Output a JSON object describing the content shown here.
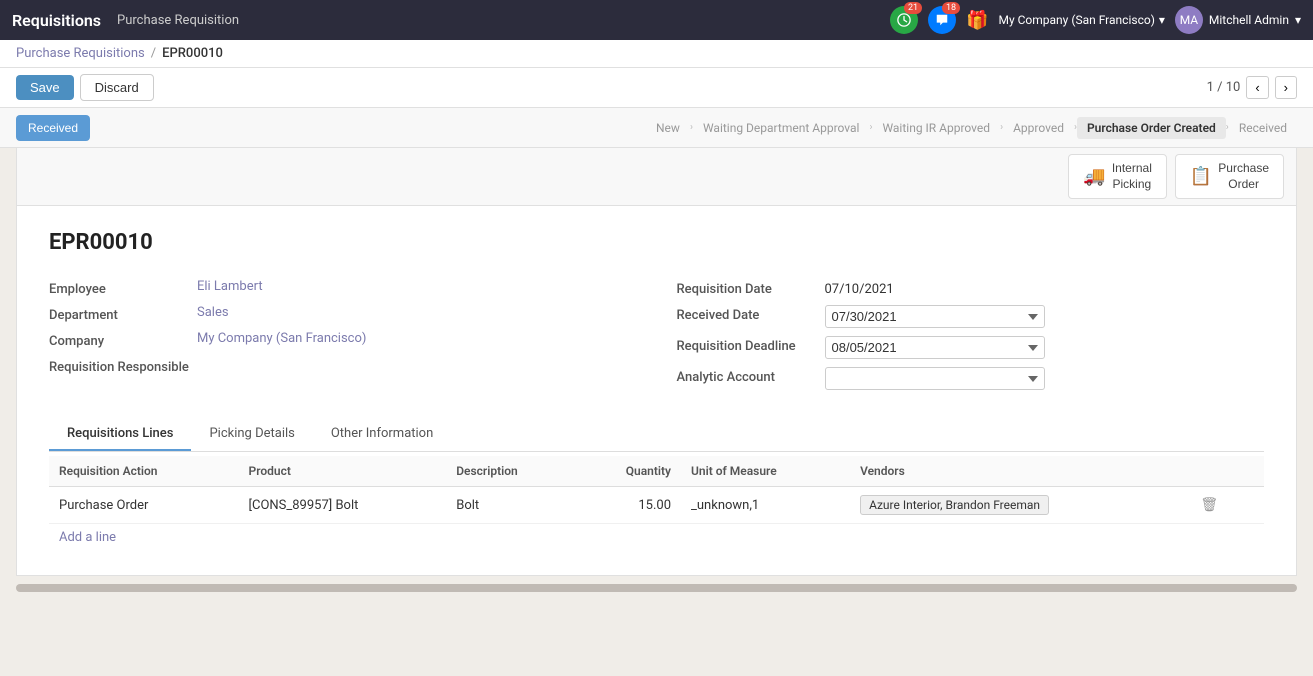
{
  "app": {
    "brand": "Requisitions",
    "module": "Purchase Requisition"
  },
  "topnav": {
    "notifications_count": "21",
    "messages_count": "18",
    "company": "My Company (San Francisco)",
    "user": "Mitchell Admin",
    "chevron": "▾"
  },
  "breadcrumb": {
    "parent": "Purchase Requisitions",
    "separator": "/",
    "current": "EPR00010"
  },
  "actions": {
    "save": "Save",
    "discard": "Discard",
    "pager": "1 / 10",
    "prev": "‹",
    "next": "›"
  },
  "status": {
    "received_label": "Received",
    "pipeline": [
      {
        "label": "New",
        "active": false
      },
      {
        "label": "Waiting Department Approval",
        "active": false
      },
      {
        "label": "Waiting IR Approved",
        "active": false
      },
      {
        "label": "Approved",
        "active": false
      },
      {
        "label": "Purchase Order Created",
        "active": true
      },
      {
        "label": "Received",
        "active": false
      }
    ]
  },
  "smart_buttons": [
    {
      "name": "internal-picking",
      "icon": "🚚",
      "label": "Internal\nPicking"
    },
    {
      "name": "purchase-order",
      "icon": "📋",
      "label": "Purchase\nOrder"
    }
  ],
  "form": {
    "title": "EPR00010",
    "left": {
      "employee_label": "Employee",
      "employee_value": "Eli Lambert",
      "department_label": "Department",
      "department_value": "Sales",
      "company_label": "Company",
      "company_value": "My Company (San Francisco)",
      "responsible_label": "Requisition Responsible",
      "responsible_value": ""
    },
    "right": {
      "req_date_label": "Requisition Date",
      "req_date_value": "07/10/2021",
      "received_date_label": "Received Date",
      "received_date_value": "07/30/2021",
      "req_deadline_label": "Requisition Deadline",
      "req_deadline_value": "08/05/2021",
      "analytic_label": "Analytic Account",
      "analytic_value": ""
    }
  },
  "tabs": [
    {
      "label": "Requisitions Lines",
      "active": true
    },
    {
      "label": "Picking Details",
      "active": false
    },
    {
      "label": "Other Information",
      "active": false
    }
  ],
  "table": {
    "columns": [
      "Requisition Action",
      "Product",
      "Description",
      "Quantity",
      "Unit of Measure",
      "Vendors"
    ],
    "rows": [
      {
        "action": "Purchase Order",
        "product": "[CONS_89957] Bolt",
        "description": "Bolt",
        "quantity": "15.00",
        "uom": "_unknown,1",
        "vendor": "Azure Interior, Brandon Freeman"
      }
    ],
    "add_line": "Add a line"
  }
}
